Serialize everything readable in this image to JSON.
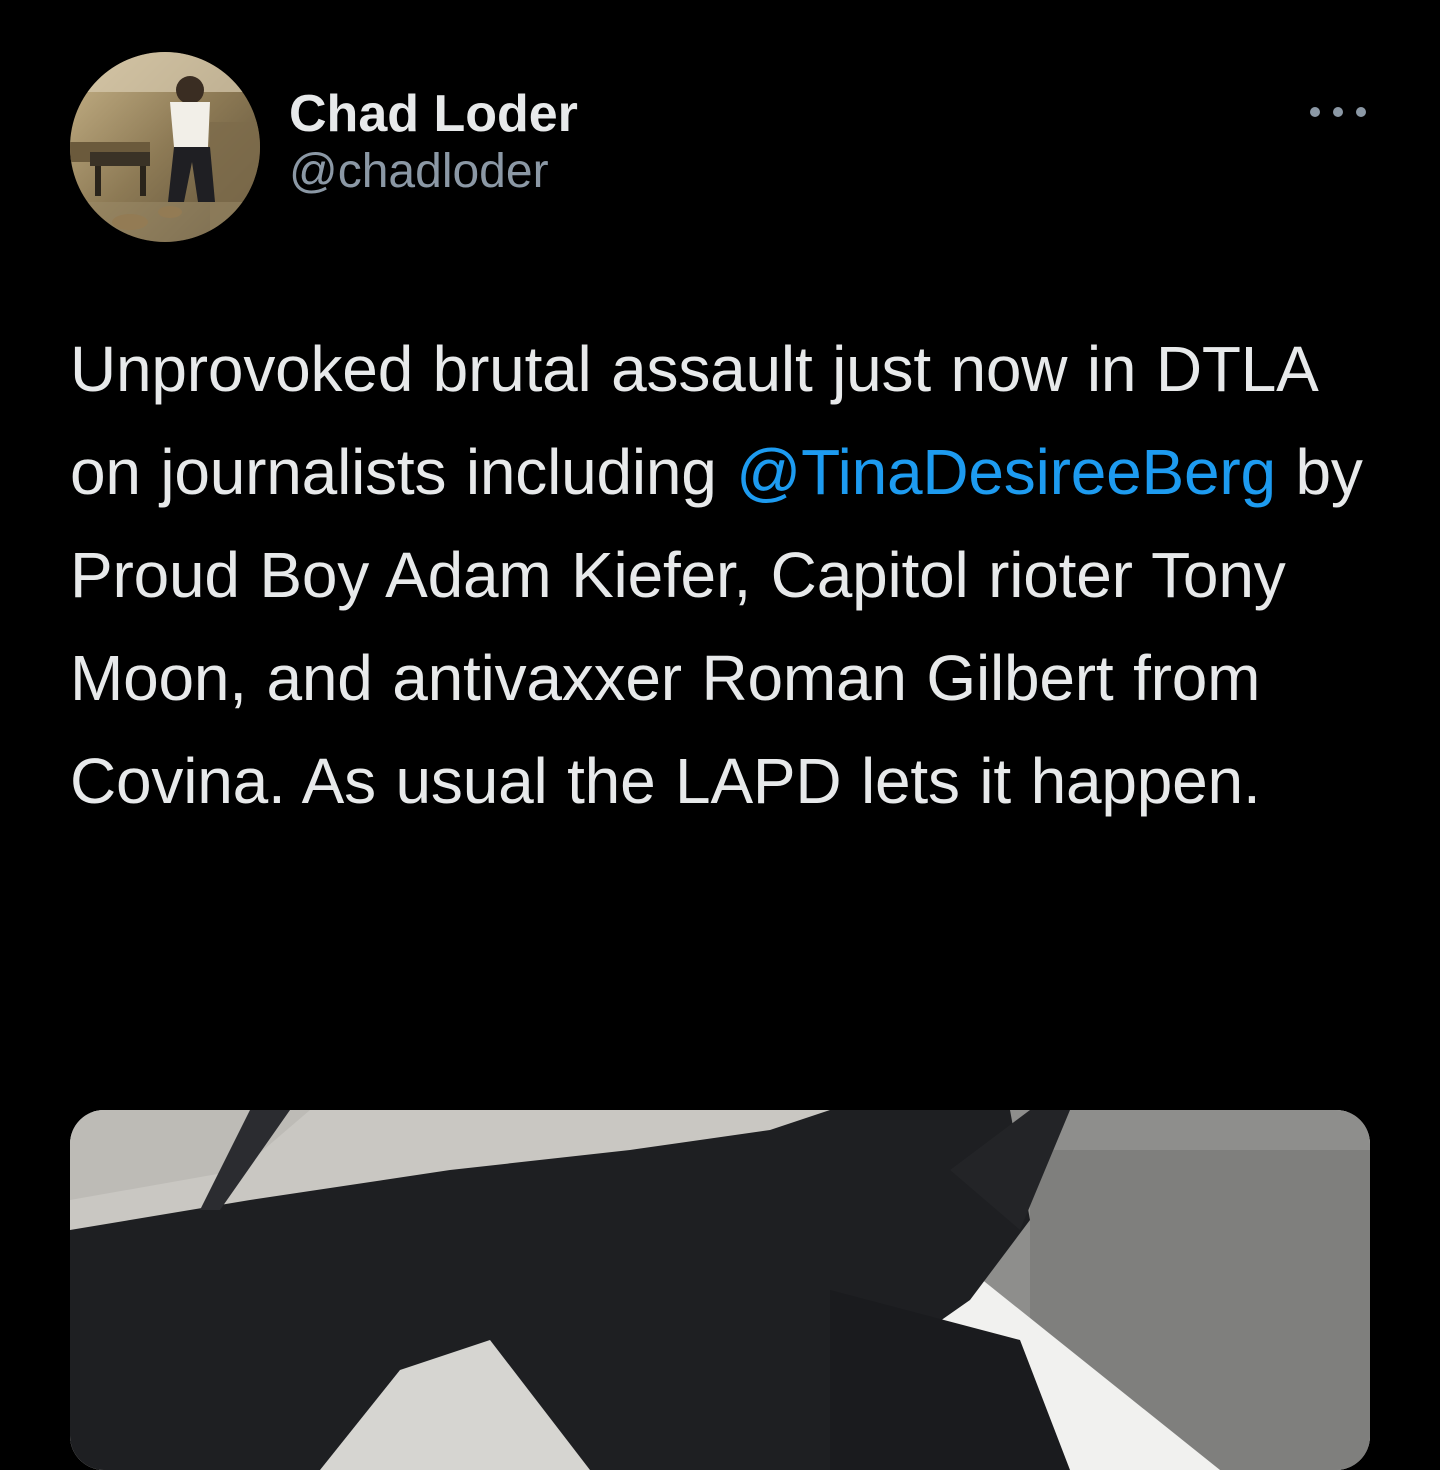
{
  "tweet": {
    "author": {
      "display_name": "Chad Loder",
      "handle": "@chadloder"
    },
    "more_icon": "more-horizontal-icon",
    "text": {
      "before_mention": "Unprovoked brutal assault just now in DTLA on journalists including ",
      "mention": "@TinaDesireeBerg",
      "after_mention": " by Proud Boy Adam Kiefer, Capitol rioter Tony Moon, and antivaxxer Roman Gilbert from Covina. As usual the LAPD lets it happen."
    },
    "colors": {
      "background": "#000000",
      "text": "#e7e9ea",
      "secondary_text": "#8b98a5",
      "link": "#1d9bf0"
    }
  }
}
